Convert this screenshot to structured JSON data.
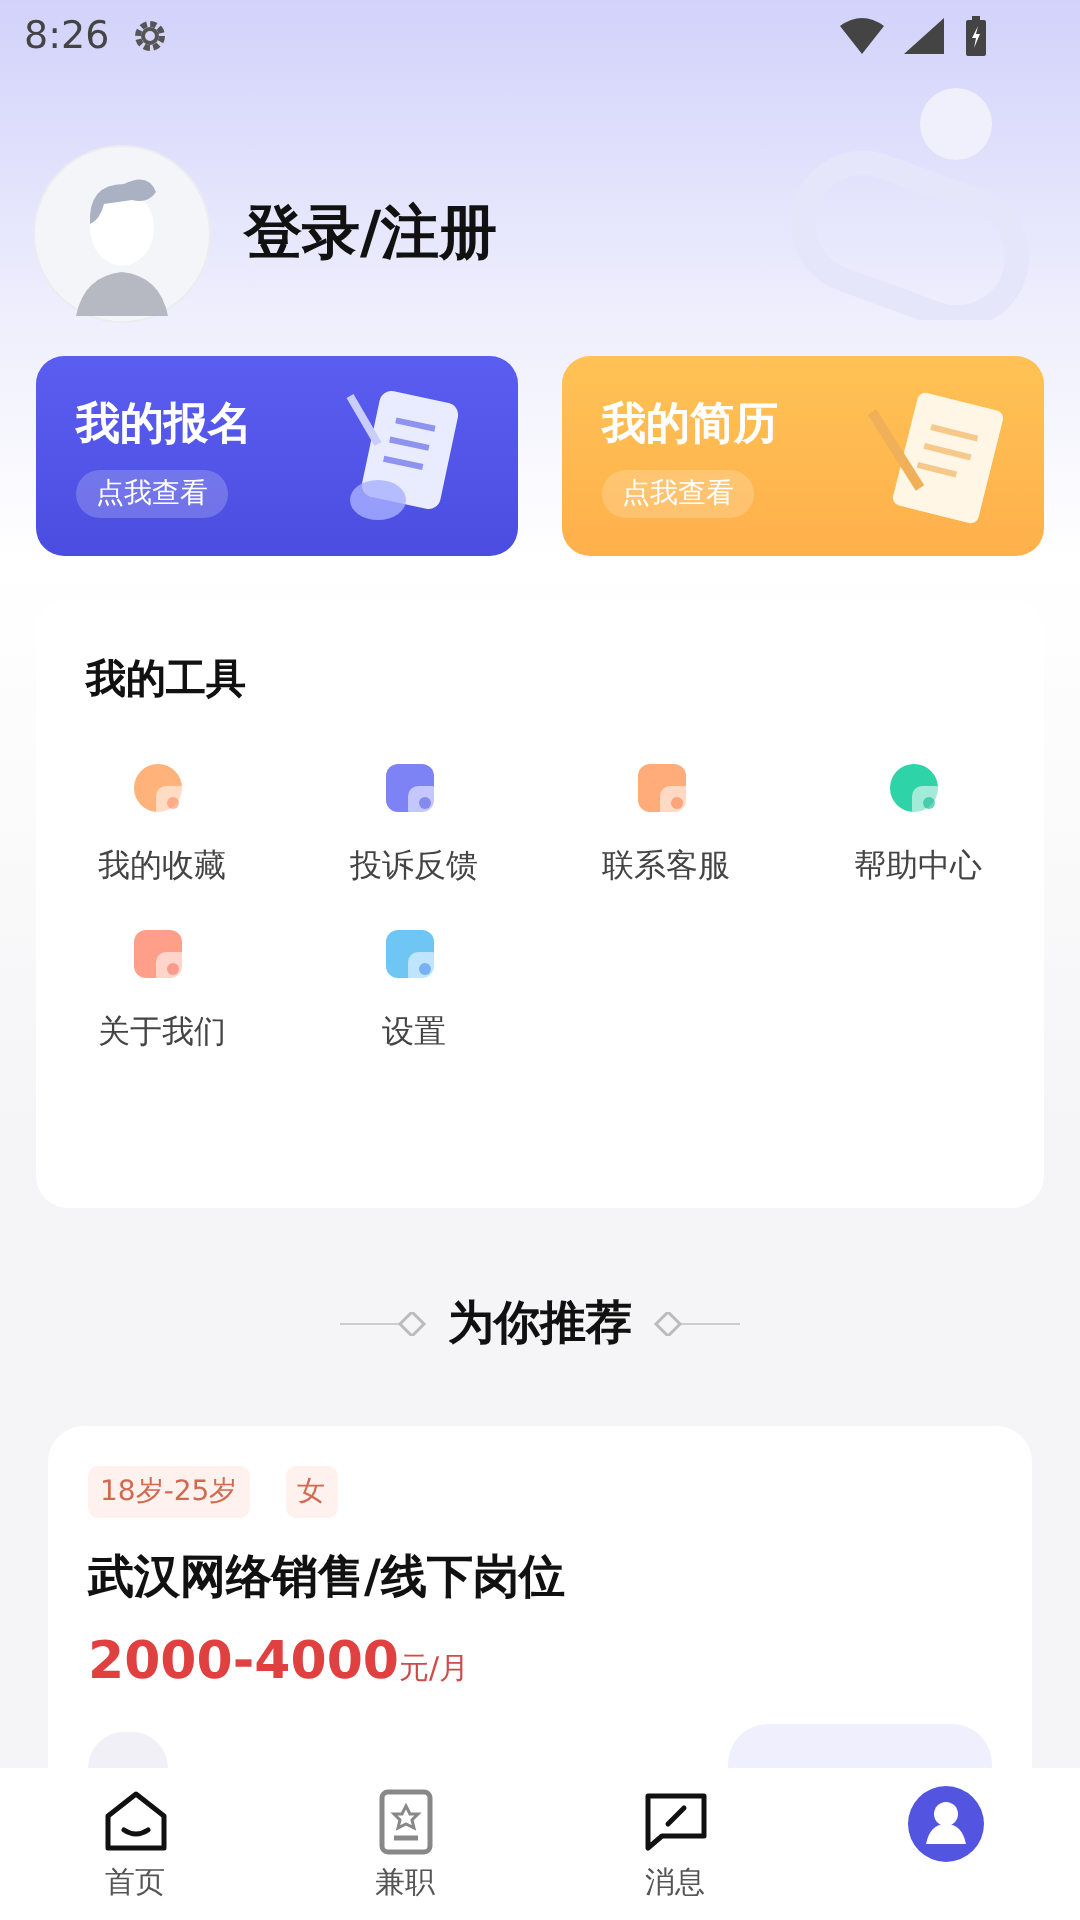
{
  "status_bar": {
    "time": "8:26"
  },
  "profile": {
    "login_label": "登录/注册"
  },
  "quick_cards": [
    {
      "kind": "blue",
      "title": "我的报名",
      "action": "点我查看"
    },
    {
      "kind": "orange",
      "title": "我的简历",
      "action": "点我查看"
    }
  ],
  "tools": {
    "title": "我的工具",
    "items": [
      {
        "label": "我的收藏"
      },
      {
        "label": "投诉反馈"
      },
      {
        "label": "联系客服"
      },
      {
        "label": "帮助中心"
      },
      {
        "label": "关于我们"
      },
      {
        "label": "设置"
      }
    ]
  },
  "recommend": {
    "title": "为你推荐"
  },
  "job": {
    "tags": [
      "18岁-25岁",
      "女"
    ],
    "title": "武汉网络销售/线下岗位",
    "salary": "2000-4000",
    "salary_unit": "元/月"
  },
  "bottom_nav": [
    {
      "label": "首页",
      "selected": false
    },
    {
      "label": "兼职",
      "selected": false
    },
    {
      "label": "消息",
      "selected": false
    },
    {
      "selected": true
    }
  ]
}
